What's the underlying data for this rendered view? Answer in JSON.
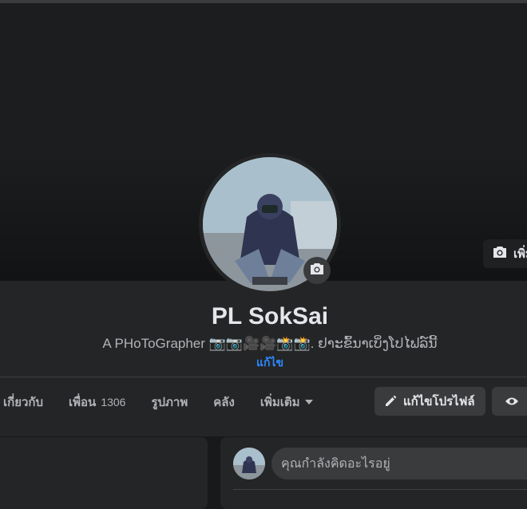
{
  "cover": {
    "add_photo_label": "เพิ่ม"
  },
  "profile": {
    "name": "PL SokSai",
    "bio": "A PHoToGrapher 📷📷🎥🎥📸📸. ຢາະຂົ້ນາເບິ່ງໂປໄຟລ໌ນີ້",
    "edit_bio_label": "แก้ไข"
  },
  "tabs": [
    {
      "label": "เกี่ยวกับ"
    },
    {
      "label": "เพื่อน",
      "count": "1306"
    },
    {
      "label": "รูปภาพ"
    },
    {
      "label": "คลัง"
    },
    {
      "label": "เพิ่มเติม"
    }
  ],
  "actions": {
    "edit_profile_label": "แก้ไขโปรไฟล์"
  },
  "composer": {
    "placeholder": "คุณกำลังคิดอะไรอยู่"
  },
  "icons": {
    "cover_camera": "camera-icon",
    "avatar_camera": "camera-icon",
    "more_dropdown": "caret-down-icon",
    "edit": "pencil-icon",
    "view": "eye-icon"
  }
}
